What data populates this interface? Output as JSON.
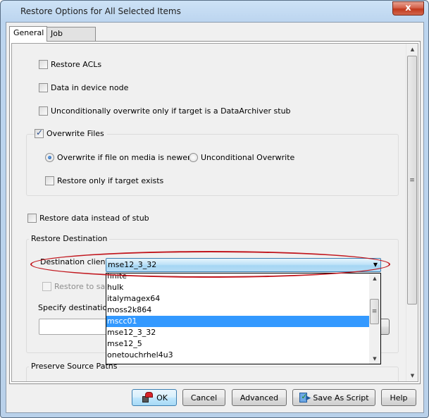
{
  "window": {
    "title": "Restore Options for All Selected Items",
    "close_glyph": "x"
  },
  "tabs": [
    {
      "label": "General",
      "active": true
    },
    {
      "label": "Job Initiation",
      "active": false
    }
  ],
  "general": {
    "restore_acls": {
      "label": "Restore ACLs",
      "checked": false
    },
    "data_in_device_node": {
      "label": "Data in device node",
      "checked": false
    },
    "unconditional_stub": {
      "label": "Unconditionally overwrite only if target is a DataArchiver stub",
      "checked": false
    },
    "overwrite_files": {
      "label": "Overwrite Files",
      "checked": true,
      "radio_newer": {
        "label": "Overwrite if file on media is newer",
        "selected": true
      },
      "radio_unconditional": {
        "label": "Unconditional Overwrite",
        "selected": false
      },
      "restore_only_if_exists": {
        "label": "Restore only if target exists",
        "checked": false
      }
    },
    "restore_data_instead_of_stub": {
      "label": "Restore data instead of stub",
      "checked": false
    },
    "restore_destination": {
      "title": "Restore Destination",
      "destination_client_label": "Destination client",
      "destination_client_value": "mse12_3_32",
      "restore_to_same_label": "Restore to same",
      "specify_path_label": "Specify destination p",
      "path_value": "",
      "dropdown_options": [
        "finite",
        "hulk",
        "italymagex64",
        "moss2k864",
        "mscc01",
        "mse12_3_32",
        "mse12_5",
        "onetouchrhel4u3"
      ],
      "dropdown_highlighted": "mscc01"
    },
    "preserve_source_paths": {
      "title": "Preserve Source Paths"
    }
  },
  "buttons": {
    "ok": "OK",
    "cancel": "Cancel",
    "advanced": "Advanced",
    "save_as_script": "Save As Script",
    "help": "Help"
  },
  "scroll_glyphs": {
    "up": "▲",
    "down": "▼",
    "grip": "≡",
    "combo_down": "▼"
  }
}
